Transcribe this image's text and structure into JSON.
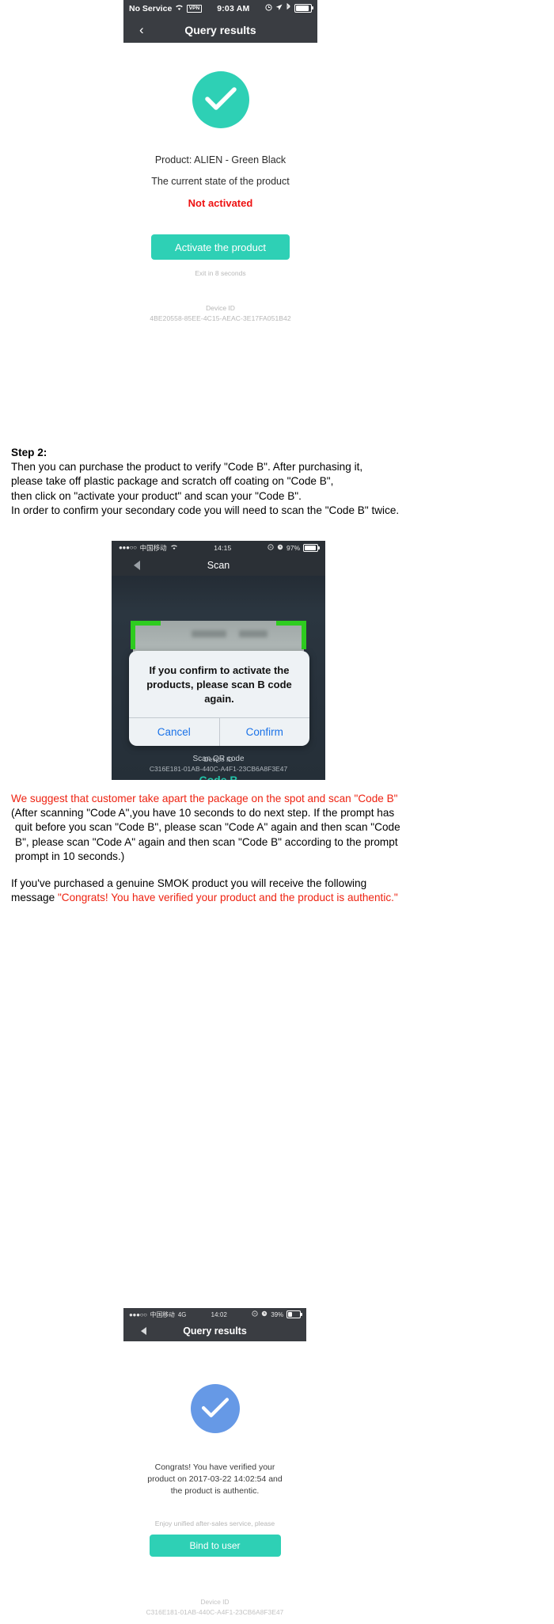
{
  "phone1": {
    "status_bar": {
      "carrier": "No Service",
      "wifi_icon": "wifi-icon",
      "vpn_label": "VPN",
      "time": "9:03 AM",
      "alarm_icon": "alarm-icon",
      "location_icon": "location-arrow-icon",
      "bluetooth_icon": "bluetooth-icon",
      "battery_icon": "battery-icon"
    },
    "nav": {
      "back_icon": "chevron-left-icon",
      "title": "Query results"
    },
    "check_icon": "check-mark-icon",
    "product_line": "Product: ALIEN - Green Black",
    "state_label": "The current state of the product",
    "state_value": "Not activated",
    "activate_button": "Activate the product",
    "exit_text": "Exit in 8 seconds",
    "device_id_label": "Device ID",
    "device_id_value": "4BE20558-85EE-4C15-AEAC-3E17FA051B42",
    "accent_color": "#2ed0b5",
    "alert_color": "#ee1111"
  },
  "step2": {
    "title": "Step 2:",
    "line1": "Then you can purchase the product to verify \"Code B\". After purchasing it,",
    "line2": "please take off plastic package and scratch off coating on \"Code B\",",
    "line3": "then click on \"activate your product\" and scan your \"Code B\".",
    "line4": "In order to confirm your secondary code you will need to scan the \"Code B\" twice."
  },
  "phone2": {
    "status_bar": {
      "signal_dots": "●●●○○",
      "carrier": "中国移动",
      "wifi_icon": "wifi-icon",
      "time": "14:15",
      "lock_rotation_icon": "rotation-lock-icon",
      "alarm_icon": "alarm-icon",
      "battery_percent": "97%",
      "battery_icon": "battery-icon"
    },
    "nav": {
      "back_icon": "back-triangle-icon",
      "title": "Scan"
    },
    "alert": {
      "message": "If you confirm to activate the products, please scan B code again.",
      "cancel": "Cancel",
      "confirm": "Confirm"
    },
    "scan_hint": "Scan QR code",
    "code_label": "Code B",
    "device_id_label": "Device ID",
    "device_id_value": "C316E181-01AB-440C-A4F1-23CB6A8F3E47",
    "code_color": "#22c3a8",
    "frame_color": "#2ecc1f"
  },
  "notes": {
    "suggestion_red": "We suggest that customer take apart the package on the spot and scan \"Code B\"",
    "paren_line1": "(After scanning \"Code A\",you have 10 seconds to do next step. If the prompt has",
    "paren_line2": "quit before you scan \"Code B\", please scan \"Code A\" again and then scan \"Code",
    "paren_line3": "B\", please scan \"Code A\" again and then scan \"Code B\" according to the prompt",
    "paren_line4": "prompt in 10 seconds.)",
    "genuine_line1": "If you've purchased a genuine SMOK product you will receive the following",
    "genuine_line2_prefix": "message ",
    "genuine_line2_red": "\"Congrats! You have verified your product and the product is authentic.\""
  },
  "phone3": {
    "status_bar": {
      "signal_dots": "●●●○○",
      "carrier": "中国移动",
      "network": "4G",
      "time": "14:02",
      "lock_rotation_icon": "rotation-lock-icon",
      "alarm_icon": "alarm-icon",
      "battery_percent": "39%",
      "battery_icon": "battery-icon"
    },
    "nav": {
      "back_icon": "back-triangle-icon",
      "title": "Query results"
    },
    "check_icon": "check-mark-icon",
    "message": "Congrats! You have verified your product on 2017-03-22 14:02:54 and the product is authentic.",
    "subtext": "Enjoy unified after-sales service, please",
    "bind_button": "Bind to user",
    "device_id_label": "Device ID",
    "device_id_value": "C316E181-01AB-440C-A4F1-23CB6A8F3E47",
    "accent_color": "#2ed0b5",
    "check_color": "#6699e6"
  }
}
